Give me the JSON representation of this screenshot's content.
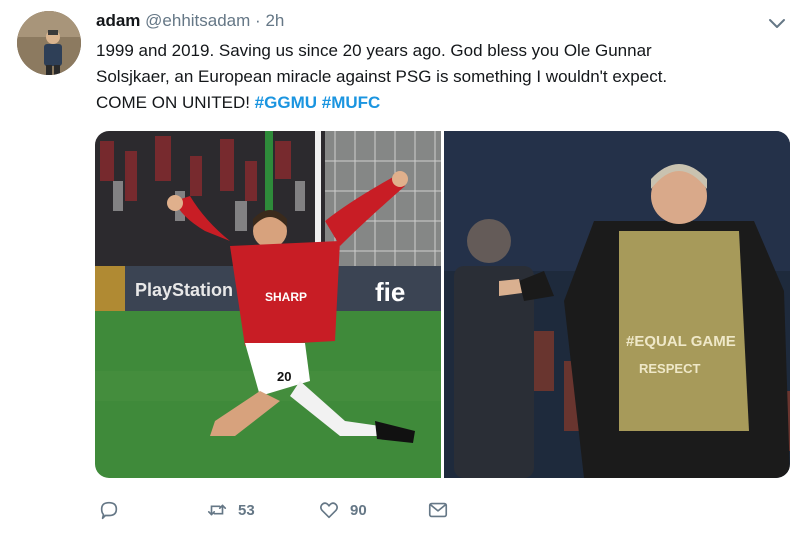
{
  "tweet": {
    "author_name": "adam",
    "author_handle": "@ehhitsadam",
    "separator": "·",
    "time": "2h",
    "text_line1": "1999 and 2019. Saving us since 20 years ago. God bless you Ole Gunnar",
    "text_line2": "Solsjkaer, an European miracle against PSG is something I wouldn't expect.",
    "text_line3_plain": "COME ON UNITED! ",
    "hashtag1": "#GGMU",
    "hashtag2": "#MUFC"
  },
  "photos": {
    "left": {
      "jersey_sponsor": "SHARP",
      "shirt_number": "20",
      "board_text_1": "PlayStation",
      "board_text_2": "fie"
    },
    "right": {
      "bib_text_1": "#EQUAL GAME",
      "bib_text_2": "RESPECT"
    }
  },
  "actions": {
    "retweet_count": "53",
    "like_count": "90"
  },
  "colors": {
    "hashtag": "#1b95e0",
    "muted": "#657786",
    "text": "#14171a"
  },
  "icons": {
    "reply": "reply-icon",
    "retweet": "retweet-icon",
    "like": "heart-icon",
    "dm": "envelope-icon",
    "menu": "chevron-down-icon"
  }
}
